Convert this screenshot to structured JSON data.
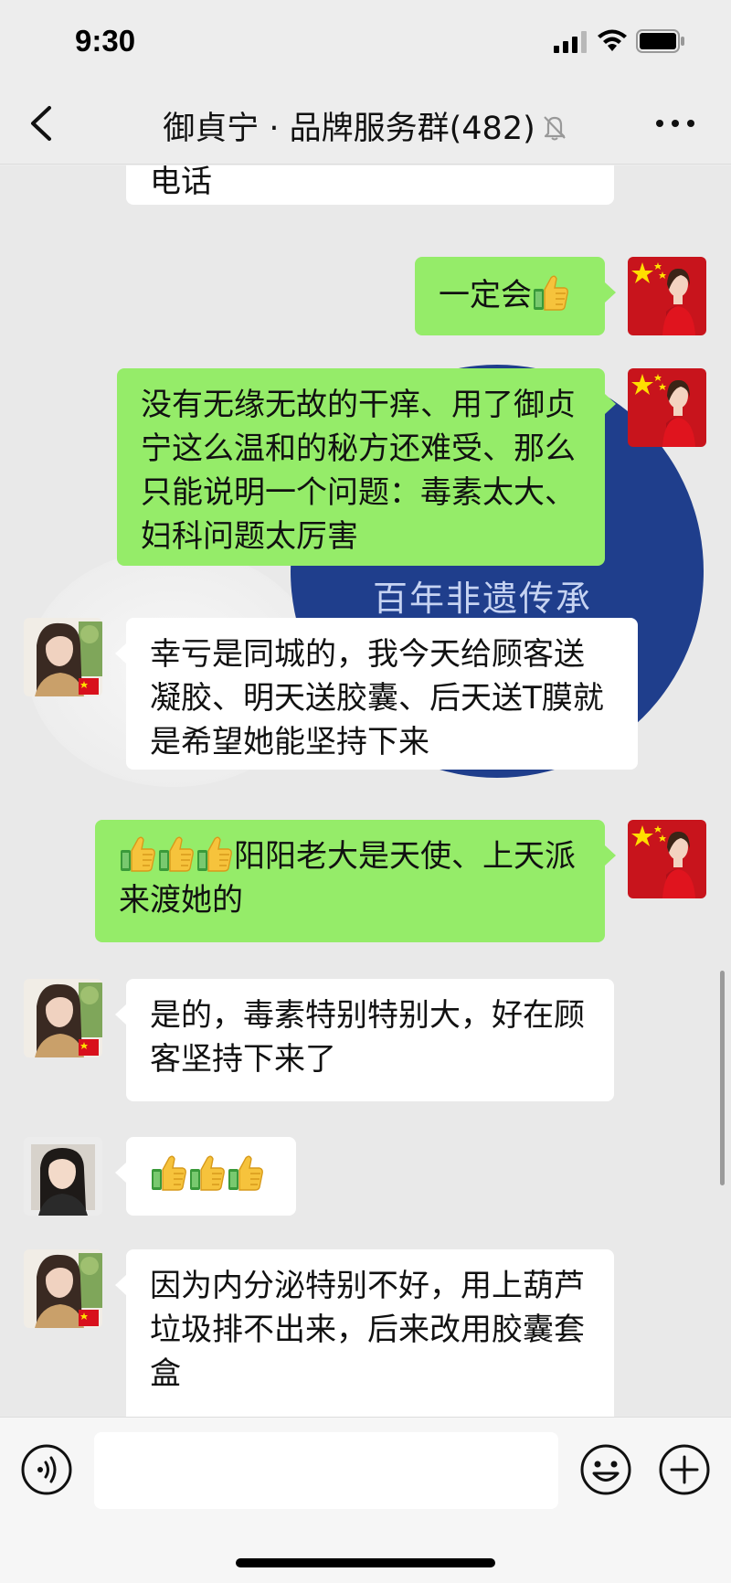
{
  "status_bar": {
    "time": "9:30"
  },
  "header": {
    "title": "御貞宁 · 品牌服务群(482)"
  },
  "background_banner": {
    "text": "百年非遗传承"
  },
  "messages": [
    {
      "side": "left",
      "text": "电话"
    },
    {
      "side": "right",
      "text": "一定会",
      "emoji_after": "thumbs-up"
    },
    {
      "side": "right",
      "text": "没有无缘无故的干痒、用了御贞宁这么温和的秘方还难受、那么只能说明一个问题：毒素太大、妇科问题太厉害"
    },
    {
      "side": "left",
      "text": "幸亏是同城的，我今天给顾客送凝胶、明天送胶囊、后天送T膜就是希望她能坚持下来"
    },
    {
      "side": "right",
      "emoji_before_count": 3,
      "text": "阳阳老大是天使、上天派来渡她的"
    },
    {
      "side": "left",
      "text": "是的，毒素特别特别大，好在顾客坚持下来了"
    },
    {
      "side": "left",
      "emoji_only_count": 3
    },
    {
      "side": "left",
      "text": "因为内分泌特别不好，用上葫芦垃圾排不出来，后来改用胶囊套盒"
    }
  ],
  "input_bar": {
    "placeholder": ""
  },
  "colors": {
    "chat_background": "#e9e9e9",
    "own_bubble": "#95ec69",
    "other_bubble": "#ffffff",
    "nav_background": "#ededed"
  },
  "icons": [
    "signal-icon",
    "wifi-icon",
    "battery-icon",
    "back-icon",
    "mute-icon",
    "more-icon",
    "thumbs-up-icon",
    "voice-icon",
    "emoji-icon",
    "plus-icon"
  ]
}
